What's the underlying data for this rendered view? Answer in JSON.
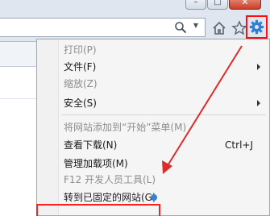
{
  "window": {
    "minimize_glyph": "–",
    "maximize_glyph": "□",
    "close_glyph": "✕"
  },
  "toolbar": {
    "icons": [
      "search-icon",
      "home-icon",
      "favorites-star-icon",
      "gear-icon"
    ],
    "address_dropdown_glyph": "▼"
  },
  "colors": {
    "highlight": "#ff0d0d",
    "annotation_arrow": "#e02b2b",
    "menu_bg": "#f5f5f5",
    "chrome_bg": "#dfe6ef",
    "disabled_text": "#8d8d8d"
  },
  "menu": {
    "items": [
      {
        "label": "打印(P)",
        "disabled": true
      },
      {
        "label": "文件(F)",
        "submenu": true
      },
      {
        "label": "缩放(Z)",
        "disabled": true
      },
      {
        "label": "安全(S)",
        "submenu": true
      },
      {
        "label": "将网站添加到“开始”菜单(M)",
        "disabled": true
      },
      {
        "label": "查看下载(N)",
        "shortcut": "Ctrl+J"
      },
      {
        "label": "管理加载项(M)"
      },
      {
        "label": "F12 开发人员工具(L)",
        "disabled": true
      },
      {
        "label": "转到已固定的网站(G)"
      }
    ]
  }
}
